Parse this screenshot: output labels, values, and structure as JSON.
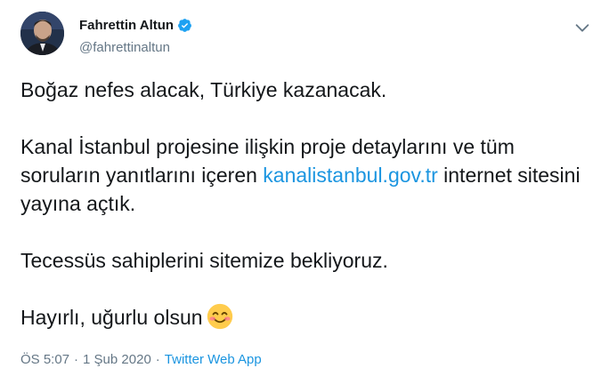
{
  "author": {
    "display_name": "Fahrettin Altun",
    "handle": "@fahrettinaltun",
    "verified_icon": "verified-badge-icon"
  },
  "tweet": {
    "line1": "Boğaz nefes alacak, Türkiye kazanacak.",
    "para2_before": "Kanal İstanbul projesine ilişkin proje detaylarını ve tüm soruların yanıtlarını içeren ",
    "para2_link": "kanalistanbul.gov.tr",
    "para2_after": " internet sitesini yayına açtık.",
    "line3": "Tecessüs sahiplerini sitemize bekliyoruz.",
    "line4": "Hayırlı, uğurlu olsun",
    "emoji": "smiling-face-with-smiling-eyes"
  },
  "meta": {
    "time": "ÖS 5:07",
    "separator1": "·",
    "date": "1 Şub 2020",
    "separator2": "·",
    "source": "Twitter Web App"
  },
  "colors": {
    "link": "#1b95e0",
    "muted": "#657786",
    "text": "#14171a"
  }
}
